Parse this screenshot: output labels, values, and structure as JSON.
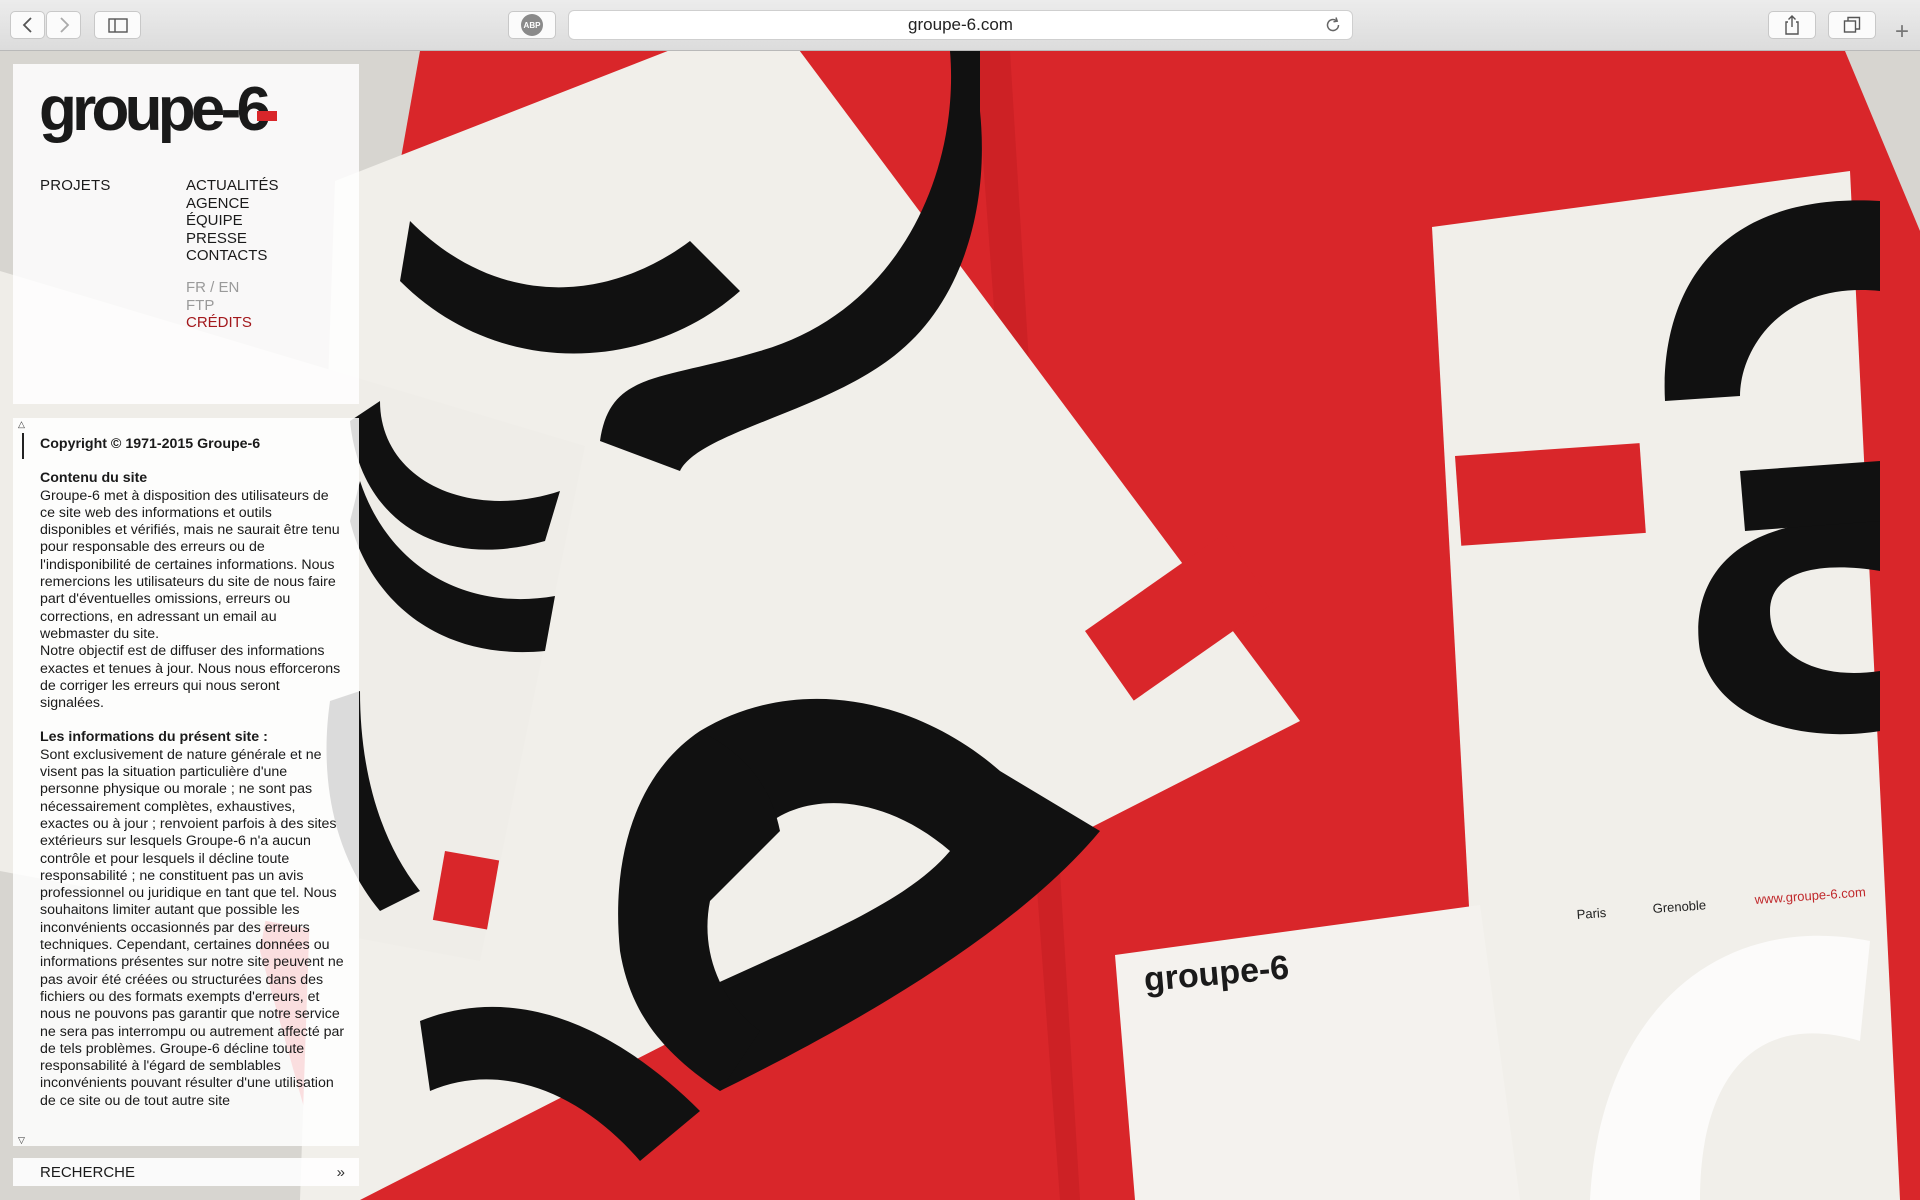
{
  "browser": {
    "url": "groupe-6.com",
    "adblock_label": "ABP",
    "new_tab_label": "+"
  },
  "site": {
    "logo_text": "groupe-6",
    "nav": {
      "projets": "PROJETS",
      "items": [
        "ACTUALITÉS",
        "AGENCE",
        "ÉQUIPE",
        "PRESSE",
        "CONTACTS"
      ],
      "language": "FR / EN",
      "ftp": "FTP",
      "credits": "CRÉDITS"
    },
    "content": {
      "copyright": "Copyright © 1971-2015 Groupe-6",
      "section1_title": "Contenu du site",
      "section1_p1": "Groupe-6 met à disposition des utilisateurs de ce site web des informations et outils disponibles et vérifiés, mais ne saurait être tenu pour responsable des erreurs ou de l'indisponibilité de certaines informations. Nous remercions les utilisateurs du site de nous faire part d'éventuelles omissions, erreurs ou corrections, en adressant un email au webmaster du site.",
      "section1_p2": "Notre objectif est de diffuser des informations exactes et tenues à jour. Nous nous efforcerons de corriger les erreurs qui nous seront signalées.",
      "section2_title": "Les informations du présent site :",
      "section2_p1": "Sont exclusivement de nature générale et ne visent pas la situation particulière d'une personne physique ou morale ; ne sont pas nécessairement complètes, exhaustives, exactes ou à jour ; renvoient parfois à des sites extérieurs sur lesquels Groupe-6 n'a aucun contrôle et pour lesquels il décline toute responsabilité ; ne constituent pas un avis professionnel ou juridique en tant que tel. Nous souhaitons limiter autant que possible les inconvénients occasionnés par des erreurs techniques. Cependant, certaines données ou informations présentes sur notre site peuvent ne pas avoir été créées ou structurées dans des fichiers ou des formats exempts d'erreurs, et nous ne pouvons pas garantir que notre service ne sera pas interrompu ou autrement affecté par de tels problèmes. Groupe-6 décline toute responsabilité à l'égard de semblables inconvénients pouvant résulter d'une utilisation de ce site ou de tout autre site"
    },
    "search_label": "RECHERCHE",
    "search_arrow": "»"
  },
  "artwork": {
    "card_cities": [
      "Paris",
      "Grenoble"
    ],
    "card_url": "www.groupe-6.com",
    "card_logo": "groupe-6"
  },
  "colors": {
    "brand_red": "#d9262a",
    "credits_red": "#a3181c",
    "ink": "#111111",
    "paper": "#f1efea"
  }
}
